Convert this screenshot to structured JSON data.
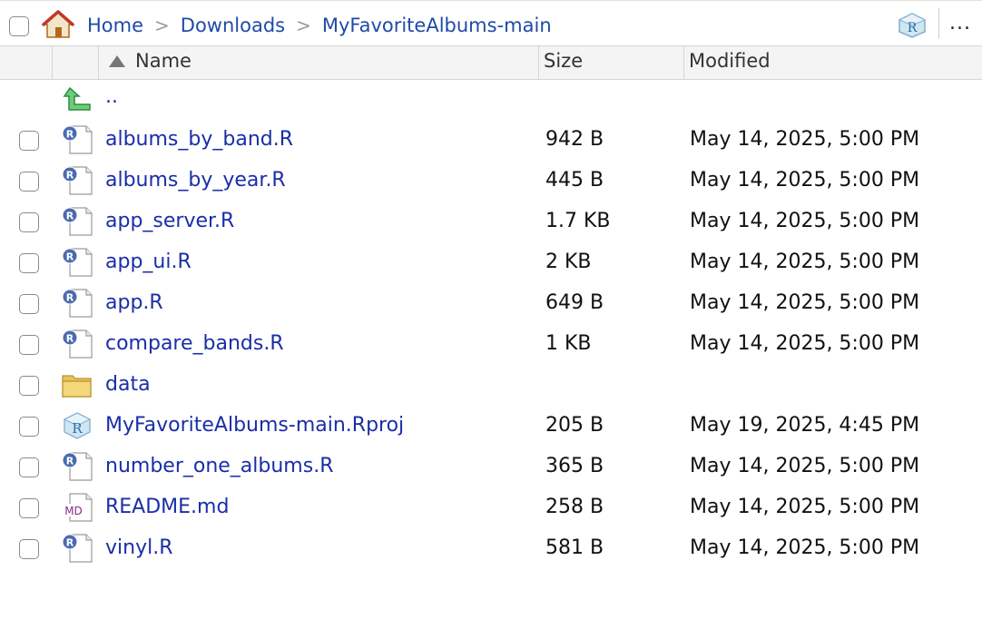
{
  "breadcrumb": {
    "items": [
      "Home",
      "Downloads",
      "MyFavoriteAlbums-main"
    ],
    "separator": ">"
  },
  "toolbar": {
    "more_label": "..."
  },
  "columns": {
    "name": "Name",
    "size": "Size",
    "modified": "Modified",
    "sort": "name-ascending"
  },
  "parent_dir": {
    "label": ".."
  },
  "files": [
    {
      "name": "albums_by_band.R",
      "size": "942 B",
      "modified": "May 14, 2025, 5:00 PM",
      "icon": "r-file-icon"
    },
    {
      "name": "albums_by_year.R",
      "size": "445 B",
      "modified": "May 14, 2025, 5:00 PM",
      "icon": "r-file-icon"
    },
    {
      "name": "app_server.R",
      "size": "1.7 KB",
      "modified": "May 14, 2025, 5:00 PM",
      "icon": "r-file-icon"
    },
    {
      "name": "app_ui.R",
      "size": "2 KB",
      "modified": "May 14, 2025, 5:00 PM",
      "icon": "r-file-icon"
    },
    {
      "name": "app.R",
      "size": "649 B",
      "modified": "May 14, 2025, 5:00 PM",
      "icon": "r-file-icon"
    },
    {
      "name": "compare_bands.R",
      "size": "1 KB",
      "modified": "May 14, 2025, 5:00 PM",
      "icon": "r-file-icon"
    },
    {
      "name": "data",
      "size": "",
      "modified": "",
      "icon": "folder-icon"
    },
    {
      "name": "MyFavoriteAlbums-main.Rproj",
      "size": "205 B",
      "modified": "May 19, 2025, 4:45 PM",
      "icon": "rproj-icon"
    },
    {
      "name": "number_one_albums.R",
      "size": "365 B",
      "modified": "May 14, 2025, 5:00 PM",
      "icon": "r-file-icon"
    },
    {
      "name": "README.md",
      "size": "258 B",
      "modified": "May 14, 2025, 5:00 PM",
      "icon": "markdown-icon"
    },
    {
      "name": "vinyl.R",
      "size": "581 B",
      "modified": "May 14, 2025, 5:00 PM",
      "icon": "r-file-icon"
    }
  ],
  "icon_text": {
    "r": "R",
    "md": "MD"
  },
  "colors": {
    "link": "#1a2ea8",
    "breadcrumb": "#1f4aa8",
    "header_bg": "#f4f4f4",
    "r_badge": "#4a6bb0",
    "md_text": "#8a2a8a"
  }
}
